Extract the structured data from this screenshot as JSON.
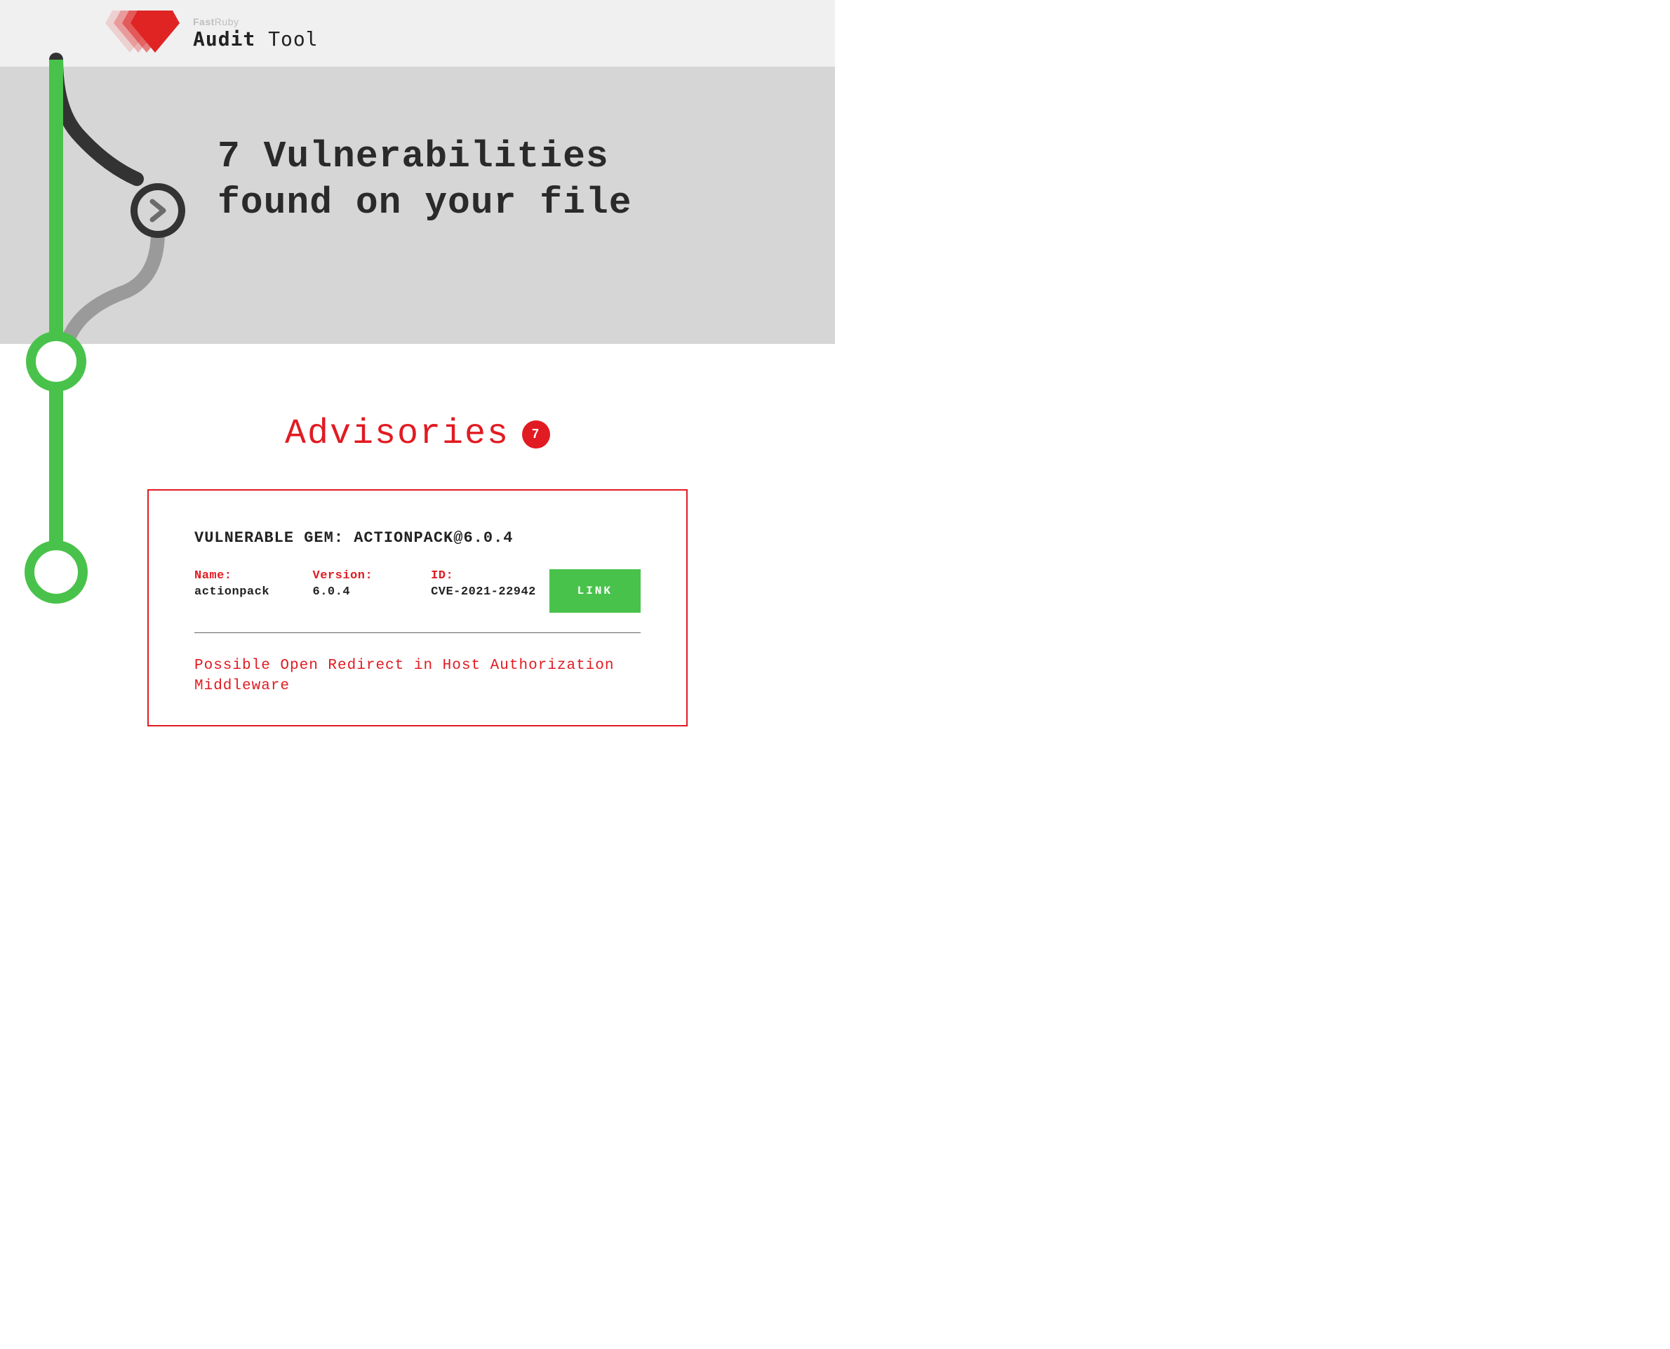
{
  "header": {
    "brand_small_bold": "Fast",
    "brand_small_light": "Ruby",
    "brand_big_bold": "Audit",
    "brand_big_thin": " Tool"
  },
  "hero": {
    "heading_line1": "7 Vulnerabilities",
    "heading_line2": "found on your file"
  },
  "advisories": {
    "title": "Advisories",
    "count": "7"
  },
  "card": {
    "title": "VULNERABLE GEM: ACTIONPACK@6.0.4",
    "name_label": "Name:",
    "name_value": "actionpack",
    "version_label": "Version:",
    "version_value": "6.0.4",
    "id_label": "ID:",
    "id_value": "CVE-2021-22942",
    "link_label": "LINK",
    "description": "Possible Open Redirect in Host Authorization Middleware"
  },
  "colors": {
    "accent": "#e11b22",
    "green": "#49c24b"
  }
}
